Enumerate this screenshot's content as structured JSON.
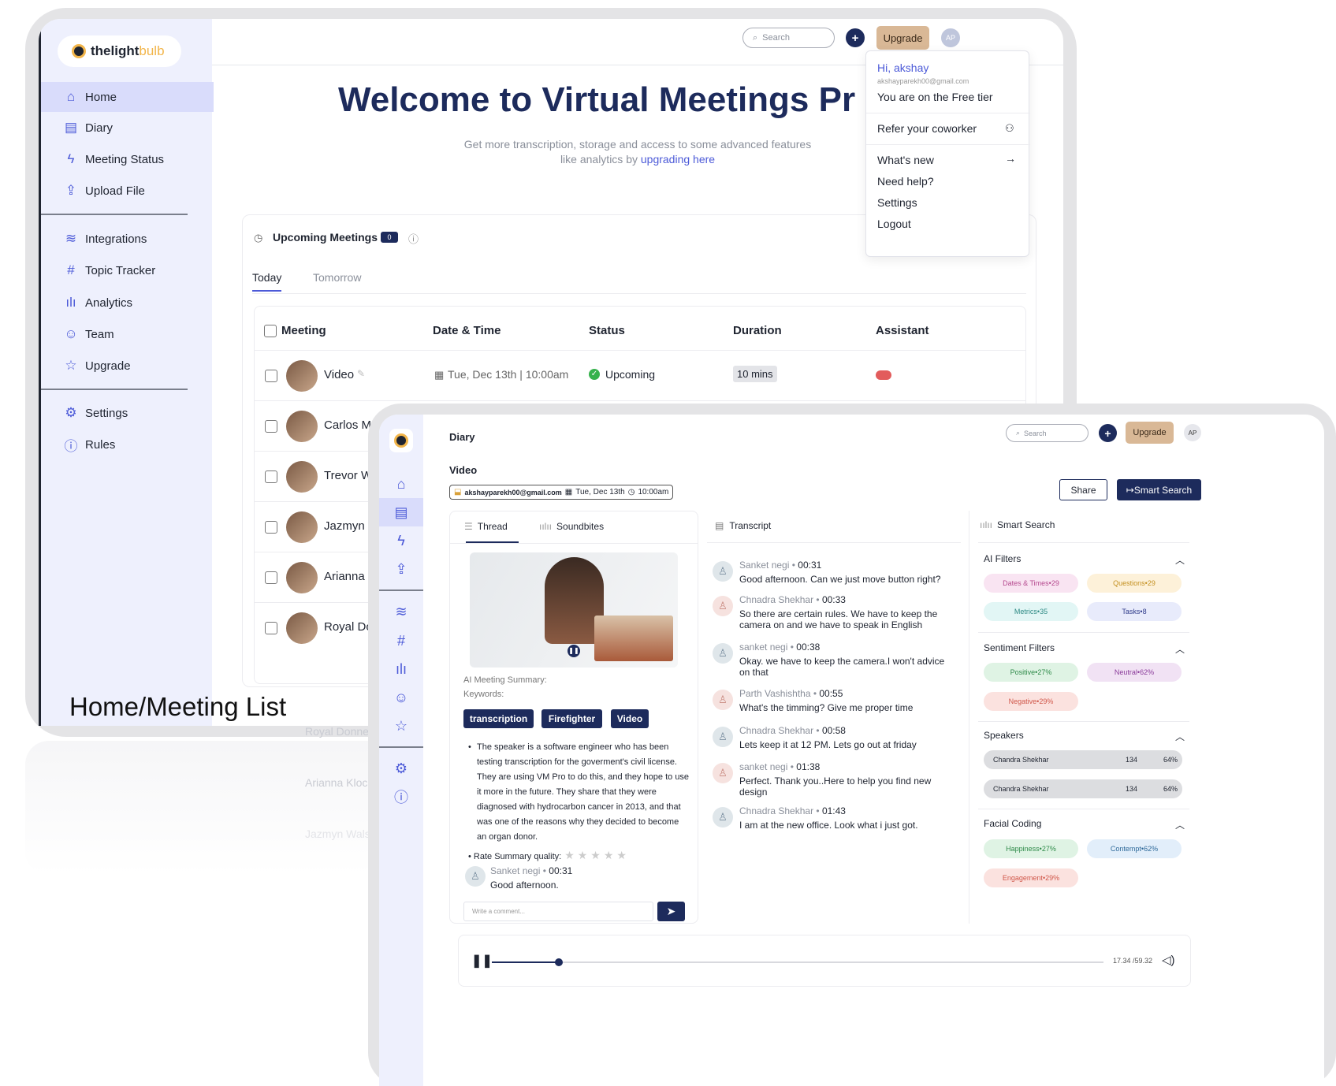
{
  "home": {
    "logo_main": "thelight",
    "logo_accent": "bulb",
    "nav": [
      "Home",
      "Diary",
      "Meeting Status",
      "Upload File",
      "Integrations",
      "Topic Tracker",
      "Analytics",
      "Team",
      "Upgrade",
      "Settings",
      "Rules"
    ],
    "search_placeholder": "Search",
    "upgrade": "Upgrade",
    "avatar": "AP",
    "title": "Welcome to Virtual Meetings Pr",
    "subtitle_1": "Get more transcription, storage and access to some advanced features",
    "subtitle_2": "like analytics by ",
    "subtitle_link": "upgrading here",
    "menu": {
      "greet": "Hi, akshay",
      "email": "akshayparekh00@gmail.com",
      "tier": "You are on the Free tier",
      "refer": "Refer your coworker",
      "whats_new": "What's new",
      "help": "Need help?",
      "settings": "Settings",
      "logout": "Logout"
    },
    "upcoming": {
      "title": "Upcoming Meetings",
      "count": "0",
      "tabs": [
        "Today",
        "Tomorrow"
      ],
      "headers": [
        "Meeting",
        "Date & Time",
        "Status",
        "Duration",
        "Assistant"
      ],
      "rows": [
        {
          "name": "Video",
          "date": "Tue, Dec 13th | 10:00am",
          "status": "Upcoming",
          "duration": "10 mins"
        },
        {
          "name": "Carlos Marvin"
        },
        {
          "name": "Trevor Witting"
        },
        {
          "name": "Jazmyn Walsc"
        },
        {
          "name": "Arianna Klock"
        },
        {
          "name": "Royal Donnell"
        }
      ]
    },
    "ghost_rows": [
      "Royal Donnell",
      "Arianna Klock",
      "Jazmyn Walsc"
    ]
  },
  "caption": "Home/Meeting List",
  "diary": {
    "page": "Diary",
    "search_placeholder": "Search",
    "upgrade": "Upgrade",
    "avatar": "AP",
    "meeting_title": "Video",
    "email": "akshayparekh00@gmail.com",
    "date": "Tue, Dec 13th",
    "time": "10:00am",
    "share": "Share",
    "smart_search_btn": "↦Smart Search",
    "tabs": [
      "Thread",
      "Soundbites"
    ],
    "transcript_title": "Transcript",
    "smart_title": "Smart Search",
    "summary_label": "AI Meeting Summary:",
    "keywords_label": "Keywords:",
    "keywords": [
      "transcription",
      "Firefighter",
      "Video"
    ],
    "summary": "The speaker is a software engineer who has been testing transcription for the goverment's civil license. They are using VM Pro to do this, and they hope to use it more in the future. They share that they were diagnosed with hydrocarbon cancer in 2013, and that was one of the reasons why they decided to become an organ donor.",
    "rate_label": "Rate Summary quality:",
    "rating": 0,
    "comment": {
      "name": "Sanket negi",
      "time": "00:31",
      "text": "Good afternoon."
    },
    "comment_placeholder": "Write a comment...",
    "transcript": [
      {
        "name": "Sanket negi",
        "time": "00:31",
        "text": "Good afternoon. Can we just move button right?"
      },
      {
        "name": "Chnadra Shekhar",
        "time": "00:33",
        "text": "So there are certain rules. We have to keep the camera on and we have to speak in English"
      },
      {
        "name": "sanket negi",
        "time": "00:38",
        "text": "Okay. we have to keep the camera.I won't advice on that"
      },
      {
        "name": "Parth Vashishtha",
        "time": "00:55",
        "text": "What's the timming? Give me proper time"
      },
      {
        "name": "Chnadra Shekhar",
        "time": "00:58",
        "text": "Lets keep it at 12 PM. Lets go out at friday"
      },
      {
        "name": "sanket negi",
        "time": "01:38",
        "text": "Perfect. Thank you..Here to help you find new design"
      },
      {
        "name": "Chnadra Shekhar",
        "time": "01:43",
        "text": "I am at the new office. Look what i just got."
      }
    ],
    "ai_filters": {
      "title": "AI Filters",
      "chips": [
        {
          "label": "Dates & Times",
          "count": "29"
        },
        {
          "label": "Questions",
          "count": "29"
        },
        {
          "label": "Metrics",
          "count": "35"
        },
        {
          "label": "Tasks",
          "count": "8"
        }
      ]
    },
    "sentiment": {
      "title": "Sentiment Filters",
      "chips": [
        {
          "label": "Positive",
          "count": "27%"
        },
        {
          "label": "Neutral",
          "count": "62%"
        },
        {
          "label": "Negative",
          "count": "29%"
        }
      ]
    },
    "speakers": {
      "title": "Speakers",
      "rows": [
        {
          "name": "Chandra Shekhar",
          "a": "134",
          "b": "64%"
        },
        {
          "name": "Chandra Shekhar",
          "a": "134",
          "b": "64%"
        }
      ]
    },
    "facial": {
      "title": "Facial Coding",
      "chips": [
        {
          "label": "Happiness",
          "count": "27%"
        },
        {
          "label": "Contempt",
          "count": "62%"
        },
        {
          "label": "Engagement",
          "count": "29%"
        }
      ]
    },
    "player": {
      "time": "17.34 /59.32",
      "progress": 0.11
    }
  }
}
